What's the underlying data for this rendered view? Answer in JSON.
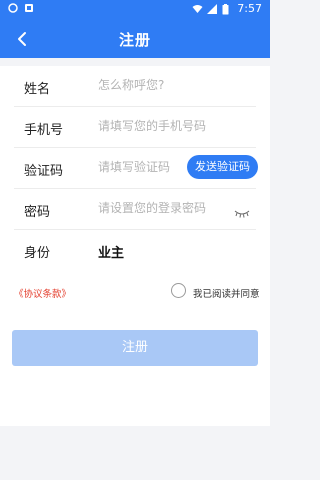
{
  "status_bar": {
    "time": "7:57"
  },
  "header": {
    "title": "注册"
  },
  "form": {
    "name": {
      "label": "姓名",
      "placeholder": "怎么称呼您?"
    },
    "phone": {
      "label": "手机号",
      "placeholder": "请填写您的手机号码"
    },
    "code": {
      "label": "验证码",
      "placeholder": "请填写验证码",
      "send_button": "发送验证码"
    },
    "password": {
      "label": "密码",
      "placeholder": "请设置您的登录密码"
    },
    "identity": {
      "label": "身份",
      "value": "业主"
    }
  },
  "agreement": {
    "link_text": "《协议条款》",
    "checkbox_label": "我已阅读并同意"
  },
  "submit_label": "注册",
  "colors": {
    "primary": "#2f7cf4",
    "disabled_button": "#a9c8f6",
    "link_red": "#e33d2c"
  }
}
